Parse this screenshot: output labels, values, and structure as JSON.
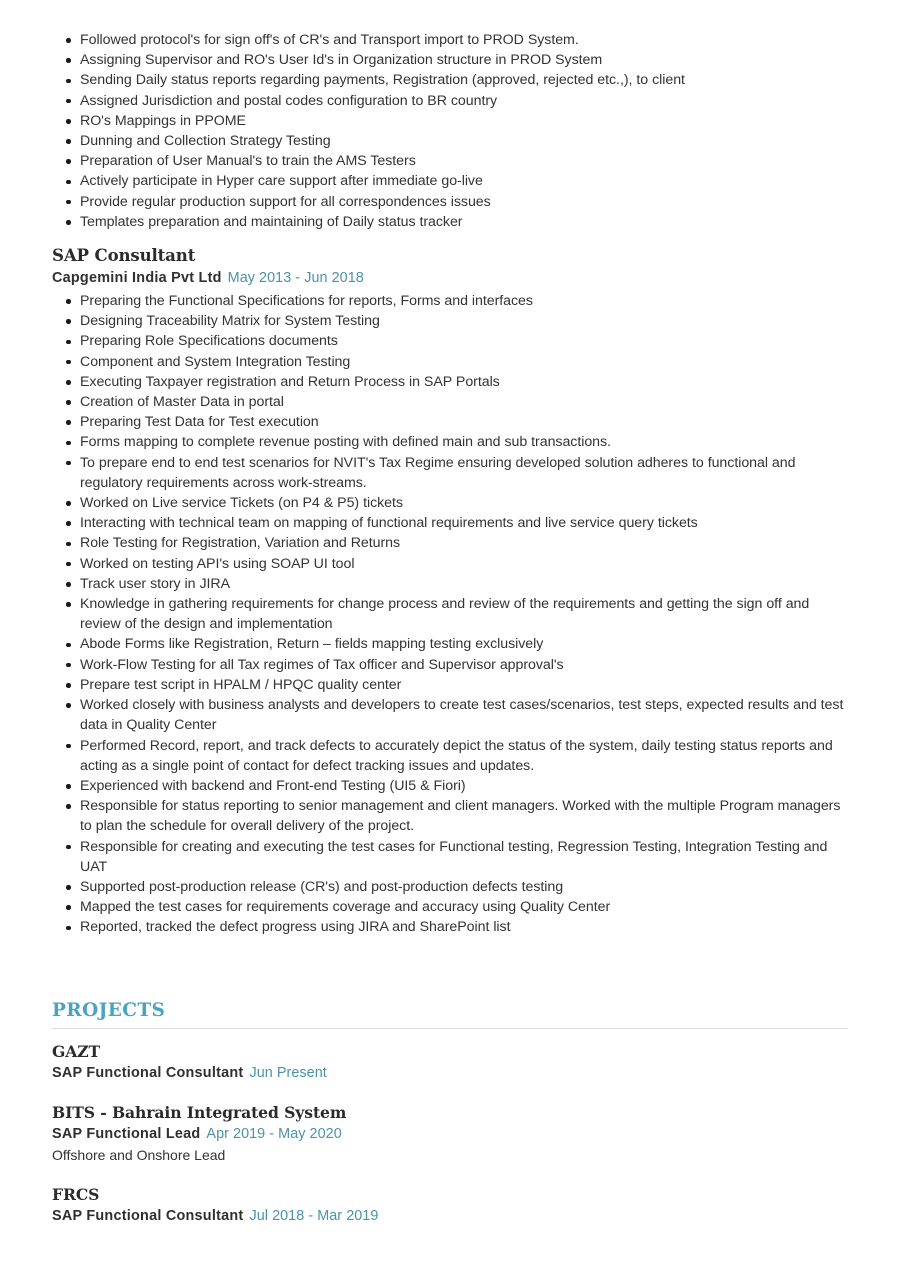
{
  "document": {
    "type": "resume",
    "accent_color": "#4aa3bf",
    "date_color": "#4a93a8",
    "body_color": "#333333",
    "heading_color": "#2b2b2b",
    "divider_color": "#dcdcdc",
    "background": "#ffffff"
  },
  "top_bullets": [
    "Followed protocol's for sign off's of CR's and Transport import to PROD System.",
    "Assigning Supervisor and RO's User Id's in Organization structure in PROD System",
    "Sending Daily status reports regarding payments, Registration (approved, rejected etc.,), to client",
    "Assigned Jurisdiction and postal codes configuration to BR country",
    "RO's Mappings in PPOME",
    "Dunning and Collection Strategy Testing",
    "Preparation of User Manual's to train the AMS Testers",
    "Actively participate in Hyper care support after immediate go-live",
    "Provide regular production support for all correspondences issues",
    "Templates preparation and maintaining of Daily status tracker"
  ],
  "experience": {
    "title": "SAP Consultant",
    "organization": "Capgemini India Pvt Ltd",
    "dates": "May 2013 - Jun 2018",
    "bullets": [
      "Preparing the Functional Specifications for reports, Forms and interfaces",
      "Designing Traceability Matrix for System Testing",
      "Preparing Role Specifications documents",
      "Component and System Integration Testing",
      "Executing Taxpayer registration and Return Process in SAP Portals",
      "Creation of Master Data in portal",
      "Preparing Test Data for Test execution",
      "Forms mapping to complete revenue posting with defined main and sub transactions.",
      "To prepare end to end test scenarios for NVIT's Tax Regime ensuring developed solution adheres to functional and regulatory requirements across work-streams.",
      "Worked on Live service Tickets (on P4 & P5) tickets",
      "Interacting with technical team on mapping of functional requirements and live service query tickets",
      "Role Testing for Registration, Variation and Returns",
      "Worked on testing API's using SOAP UI tool",
      "Track user story in JIRA",
      "Knowledge in gathering requirements for change process and review of the requirements and getting the sign off and review of the design and implementation",
      "Abode Forms like Registration, Return – fields mapping testing exclusively",
      "Work-Flow Testing for all Tax regimes of Tax officer and Supervisor approval's",
      "Prepare test script in HPALM / HPQC quality center",
      "Worked closely with business analysts and developers to create test cases/scenarios, test steps, expected results and test data in Quality Center",
      "Performed Record, report, and track defects to accurately depict the status of the system, daily testing status reports and acting as a single point of contact for defect tracking issues and updates.",
      "Experienced with backend and Front-end Testing (UI5 & Fiori)",
      "Responsible for status reporting to senior management and client managers. Worked with the multiple Program managers to plan the schedule for overall delivery of the project.",
      "Responsible for creating and executing the test cases for Functional testing, Regression Testing, Integration Testing and UAT",
      "Supported post-production release (CR's) and post-production defects testing",
      "Mapped the test cases for requirements coverage and accuracy using Quality Center",
      "Reported, tracked the defect progress using JIRA and SharePoint list"
    ]
  },
  "projects_section": {
    "heading": "PROJECTS",
    "items": [
      {
        "name": "GAZT",
        "role": "SAP Functional Consultant",
        "dates": "Jun Present",
        "note": ""
      },
      {
        "name": "BITS - Bahrain Integrated System",
        "role": "SAP Functional Lead",
        "dates": "Apr 2019 - May 2020",
        "note": "Offshore and Onshore Lead"
      },
      {
        "name": "FRCS",
        "role": "SAP Functional Consultant",
        "dates": "Jul 2018 - Mar 2019",
        "note": ""
      }
    ]
  }
}
